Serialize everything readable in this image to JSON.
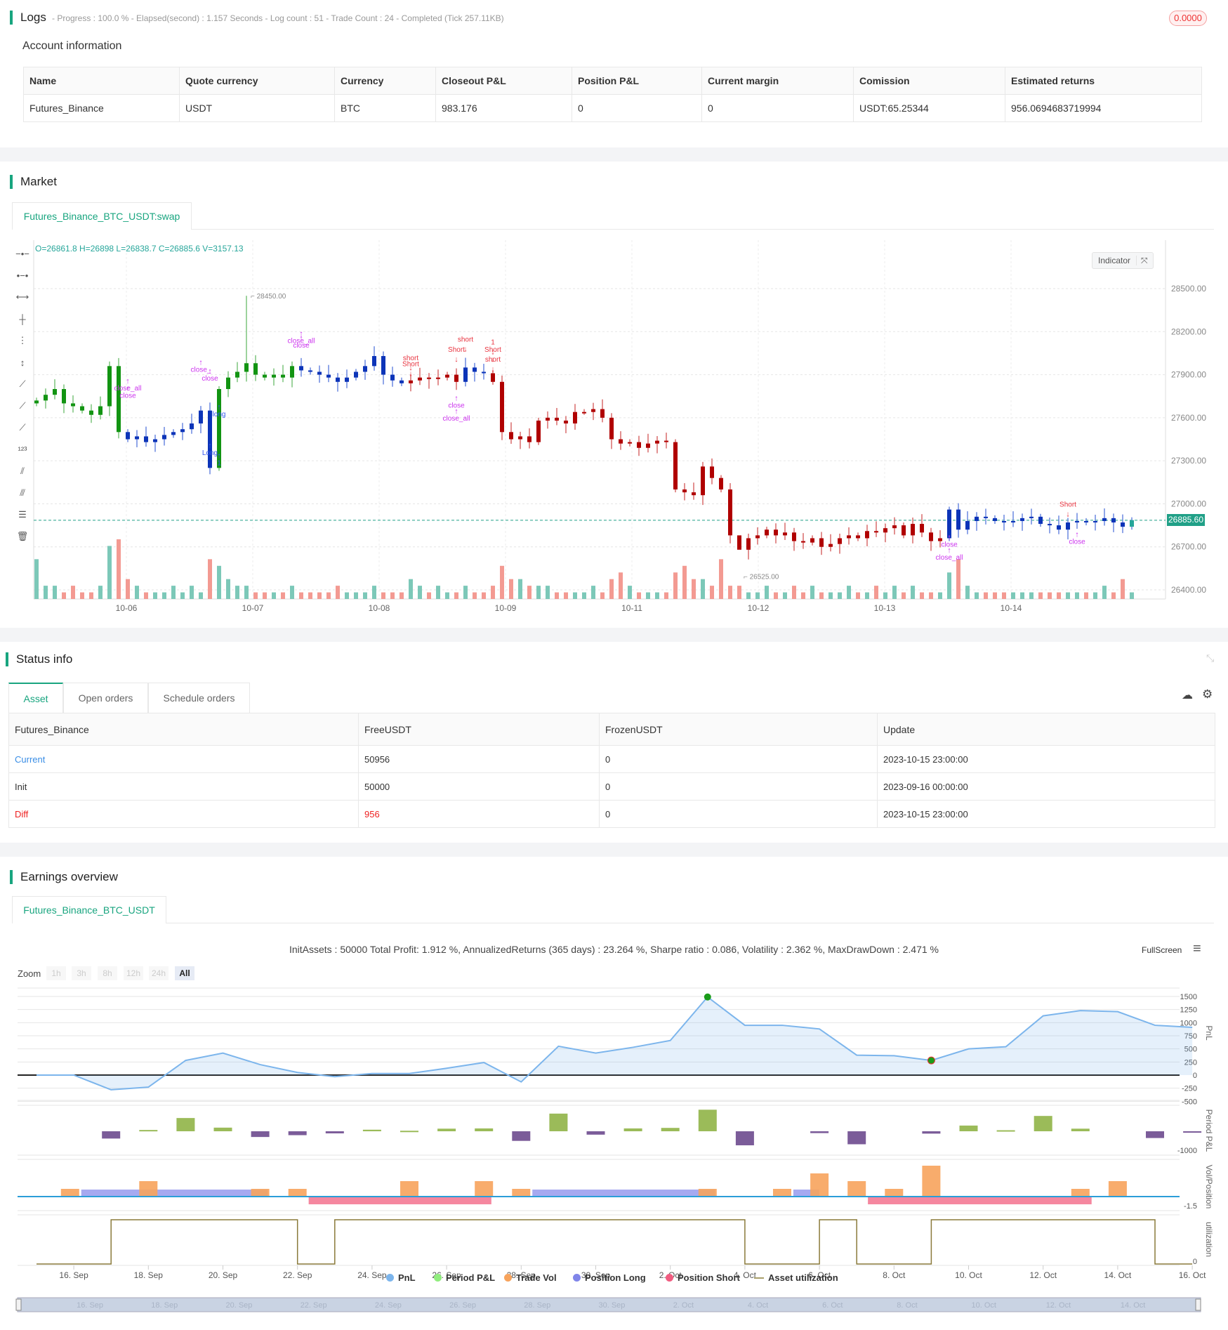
{
  "logs": {
    "title": "Logs",
    "summary": "- Progress : 100.0 % - Elapsed(second) : 1.157  Seconds - Log count : 51 - Trade Count : 24 - Completed (Tick 257.11KB)",
    "badge": "0.0000"
  },
  "account": {
    "title": "Account information",
    "headers": [
      "Name",
      "Quote currency",
      "Currency",
      "Closeout P&L",
      "Position P&L",
      "Current margin",
      "Comission",
      "Estimated returns"
    ],
    "row": [
      "Futures_Binance",
      "USDT",
      "BTC",
      "983.176",
      "0",
      "0",
      "USDT:65.25344",
      "956.0694683719994"
    ]
  },
  "market": {
    "title": "Market",
    "tab": "Futures_Binance_BTC_USDT:swap",
    "ohlc": "O=26861.8 H=26898 L=26838.7 C=26885.6 V=3157.13",
    "indicator_label": "Indicator",
    "last_price": "26885.60"
  },
  "colors": {
    "accent": "#18a57f",
    "long": "#129412",
    "flat": "#0c34b8",
    "short": "#b00000",
    "vol_up": "#7cc8b8",
    "vol_down": "#f39a92",
    "signal": "#cc33ee"
  },
  "chart_data": [
    {
      "type": "candlestick",
      "title": "Futures_Binance_BTC_USDT:swap",
      "ylim": [
        26300,
        28750
      ],
      "yticks": [
        28500,
        28200,
        27900,
        27600,
        27300,
        27000,
        26700,
        26400
      ],
      "xticks": [
        "10-06",
        "10-07",
        "10-08",
        "10-09",
        "10-11",
        "10-12",
        "10-13",
        "10-14"
      ],
      "open_first": 27700,
      "closes": [
        27720,
        27760,
        27800,
        27700,
        27680,
        27650,
        27620,
        27680,
        27960,
        27500,
        27450,
        27470,
        27430,
        27450,
        27480,
        27500,
        27520,
        27560,
        27650,
        27250,
        27800,
        27880,
        27920,
        27980,
        27900,
        27880,
        27900,
        27880,
        27960,
        27930,
        27920,
        27900,
        27880,
        27850,
        27880,
        27920,
        27960,
        28030,
        27900,
        27860,
        27840,
        27860,
        27880,
        27870,
        27880,
        27900,
        27850,
        27950,
        27920,
        27910,
        27850,
        27500,
        27450,
        27470,
        27430,
        27580,
        27600,
        27580,
        27560,
        27640,
        27640,
        27660,
        27600,
        27450,
        27420,
        27430,
        27390,
        27420,
        27440,
        27430,
        27100,
        27080,
        27060,
        27260,
        27180,
        27100,
        26780,
        26680,
        26760,
        26780,
        26820,
        26780,
        26800,
        26740,
        26730,
        26760,
        26700,
        26720,
        26760,
        26780,
        26760,
        26810,
        26800,
        26830,
        26850,
        26780,
        26860,
        26800,
        26740,
        26760,
        26960,
        26820,
        26880,
        26910,
        26900,
        26880,
        26870,
        26880,
        26900,
        26910,
        26860,
        26850,
        26820,
        26870,
        26880,
        26870,
        26880,
        26900,
        26870,
        26840,
        26886
      ],
      "volumes": [
        6,
        2,
        2,
        1,
        2,
        1,
        1,
        2,
        8,
        9,
        3,
        2,
        1,
        1,
        1,
        2,
        1,
        2,
        1,
        6,
        5,
        3,
        2,
        2,
        1,
        1,
        1,
        1,
        2,
        1,
        1,
        1,
        1,
        2,
        1,
        1,
        1,
        2,
        1,
        1,
        1,
        3,
        2,
        1,
        2,
        1,
        1,
        2,
        1,
        1,
        2,
        5,
        3,
        3,
        2,
        2,
        2,
        1,
        1,
        1,
        1,
        2,
        1,
        3,
        4,
        2,
        1,
        1,
        1,
        1,
        4,
        5,
        3,
        3,
        2,
        6,
        2,
        2,
        1,
        1,
        2,
        1,
        1,
        2,
        1,
        2,
        1,
        1,
        1,
        2,
        1,
        1,
        2,
        1,
        2,
        1,
        2,
        1,
        1,
        1,
        4,
        6,
        2,
        1,
        1,
        1,
        1,
        1,
        1,
        1,
        1,
        1,
        1,
        1,
        1,
        1,
        1,
        2,
        1,
        3,
        1
      ],
      "states": [
        {
          "from": 0,
          "to": 9,
          "state": "long"
        },
        {
          "from": 10,
          "to": 19,
          "state": "flat"
        },
        {
          "from": 20,
          "to": 28,
          "state": "long"
        },
        {
          "from": 29,
          "to": 40,
          "state": "flat"
        },
        {
          "from": 41,
          "to": 46,
          "state": "short"
        },
        {
          "from": 47,
          "to": 49,
          "state": "flat"
        },
        {
          "from": 50,
          "to": 99,
          "state": "short"
        },
        {
          "from": 100,
          "to": 120,
          "state": "flat"
        }
      ],
      "extremes": [
        {
          "label": "28450.00",
          "i": 23,
          "price": 28450
        },
        {
          "label": "26525.00",
          "i": 77,
          "price": 26525
        }
      ],
      "signals": [
        {
          "text": "close_all",
          "i": 10,
          "price": 27790,
          "kind": "close"
        },
        {
          "text": "close",
          "i": 10,
          "price": 27740,
          "kind": "close"
        },
        {
          "text": "close_",
          "i": 18,
          "price": 27920,
          "kind": "close"
        },
        {
          "text": "close",
          "i": 19,
          "price": 27860,
          "kind": "close"
        },
        {
          "text": "Long",
          "i": 19,
          "price": 27340,
          "kind": "long"
        },
        {
          "text": "long",
          "i": 20,
          "price": 27610,
          "kind": "long"
        },
        {
          "text": "1",
          "i": 20,
          "price": 27270,
          "kind": "long"
        },
        {
          "text": "close_all",
          "i": 29,
          "price": 28120,
          "kind": "close"
        },
        {
          "text": "close",
          "i": 29,
          "price": 28090,
          "kind": "close"
        },
        {
          "text": "short",
          "i": 41,
          "price": 28000,
          "kind": "short"
        },
        {
          "text": "Short",
          "i": 41,
          "price": 27960,
          "kind": "short"
        },
        {
          "text": "short",
          "i": 47,
          "price": 28130,
          "kind": "short"
        },
        {
          "text": "Short",
          "i": 46,
          "price": 28060,
          "kind": "short"
        },
        {
          "text": "1",
          "i": 50,
          "price": 28110,
          "kind": "short"
        },
        {
          "text": "Short",
          "i": 50,
          "price": 28060,
          "kind": "short"
        },
        {
          "text": "short",
          "i": 50,
          "price": 27990,
          "kind": "short"
        },
        {
          "text": "close",
          "i": 46,
          "price": 27670,
          "kind": "close"
        },
        {
          "text": "close_all",
          "i": 46,
          "price": 27580,
          "kind": "close"
        },
        {
          "text": "close",
          "i": 100,
          "price": 26700,
          "kind": "close"
        },
        {
          "text": "close_all",
          "i": 100,
          "price": 26610,
          "kind": "close"
        },
        {
          "text": "Short",
          "i": 113,
          "price": 26980,
          "kind": "short"
        },
        {
          "text": "close",
          "i": 114,
          "price": 26720,
          "kind": "close"
        }
      ]
    },
    {
      "type": "line",
      "title": "PnL",
      "x": [
        "15 Sep",
        "16 Sep",
        "17 Sep",
        "18 Sep",
        "19 Sep",
        "20 Sep",
        "21 Sep",
        "22 Sep",
        "23 Sep",
        "24 Sep",
        "25 Sep",
        "26 Sep",
        "27 Sep",
        "28 Sep",
        "29 Sep",
        "30 Sep",
        "1 Oct",
        "2 Oct",
        "3 Oct",
        "4 Oct",
        "5 Oct",
        "6 Oct",
        "7 Oct",
        "8 Oct",
        "9 Oct",
        "10 Oct",
        "11 Oct",
        "12 Oct",
        "13 Oct",
        "14 Oct",
        "15 Oct",
        "16 Oct"
      ],
      "pnl": [
        0,
        0,
        -280,
        -230,
        280,
        420,
        200,
        50,
        -30,
        30,
        30,
        130,
        240,
        -130,
        550,
        420,
        530,
        660,
        1490,
        950,
        950,
        880,
        380,
        370,
        280,
        500,
        540,
        1130,
        1230,
        1210,
        950,
        910
      ],
      "ylim": [
        -500,
        1500
      ],
      "yticks": [
        1500,
        1250,
        1000,
        750,
        500,
        250,
        0,
        -250,
        -500
      ],
      "period_pnl": [
        0,
        0,
        -280,
        50,
        510,
        140,
        -220,
        -150,
        -80,
        60,
        20,
        100,
        110,
        -370,
        680,
        -130,
        110,
        130,
        830,
        -540,
        0,
        -70,
        -500,
        0,
        -90,
        220,
        40,
        590,
        100,
        0,
        -260,
        -40
      ],
      "period_ylabel": "-1000",
      "trade_vol": [
        {
          "day": 0.9,
          "vol": 1
        },
        {
          "day": 3,
          "vol": 2
        },
        {
          "day": 6,
          "vol": 1
        },
        {
          "day": 7,
          "vol": 1
        },
        {
          "day": 10,
          "vol": 2
        },
        {
          "day": 12,
          "vol": 2
        },
        {
          "day": 13,
          "vol": 1
        },
        {
          "day": 18,
          "vol": 1
        },
        {
          "day": 20,
          "vol": 1
        },
        {
          "day": 21,
          "vol": 3
        },
        {
          "day": 22,
          "vol": 2
        },
        {
          "day": 23,
          "vol": 1
        },
        {
          "day": 24,
          "vol": 4
        },
        {
          "day": 28,
          "vol": 1
        },
        {
          "day": 29,
          "vol": 2
        }
      ],
      "position_long": [
        [
          1.2,
          6.2
        ],
        [
          13.3,
          18.2
        ],
        [
          20.3,
          21
        ]
      ],
      "position_short": [
        [
          7.3,
          12.2
        ],
        [
          22.3,
          28.3
        ]
      ],
      "vol_ylabel": "-1.5",
      "utilization": [
        0,
        0,
        1,
        1,
        1,
        1,
        1,
        0,
        1,
        1,
        1,
        1,
        1,
        1,
        1,
        1,
        1,
        1,
        1,
        0,
        0,
        1,
        0,
        0,
        1,
        1,
        1,
        1,
        1,
        1,
        0,
        0
      ],
      "util_ylabel": "0",
      "xticks": [
        "16. Sep",
        "18. Sep",
        "20. Sep",
        "22. Sep",
        "24. Sep",
        "26. Sep",
        "28. Sep",
        "30. Sep",
        "2. Oct",
        "4. Oct",
        "6. Oct",
        "8. Oct",
        "10. Oct",
        "12. Oct",
        "14. Oct",
        "16. Oct"
      ],
      "nav_ticks": [
        "16. Sep",
        "18. Sep",
        "20. Sep",
        "22. Sep",
        "24. Sep",
        "26. Sep",
        "28. Sep",
        "30. Sep",
        "2. Oct",
        "4. Oct",
        "6. Oct",
        "8. Oct",
        "10. Oct",
        "12. Oct",
        "14. Oct"
      ],
      "axis_titles": [
        "PnL",
        "Period P&L",
        "Vol/Position",
        "utilization"
      ]
    }
  ],
  "status": {
    "title": "Status info",
    "tabs": [
      "Asset",
      "Open orders",
      "Schedule orders"
    ],
    "headers": [
      "Futures_Binance",
      "FreeUSDT",
      "FrozenUSDT",
      "Update"
    ],
    "rows": [
      [
        "Current",
        "50956",
        "0",
        "2023-10-15 23:00:00"
      ],
      [
        "Init",
        "50000",
        "0",
        "2023-09-16 00:00:00"
      ],
      [
        "Diff",
        "956",
        "0",
        "2023-10-15 23:00:00"
      ]
    ]
  },
  "earnings": {
    "title": "Earnings overview",
    "tab": "Futures_Binance_BTC_USDT",
    "stats": "InitAssets : 50000 Total Profit: 1.912 %, AnnualizedReturns (365 days) : 23.264 %, Sharpe ratio : 0.086, Volatility : 2.362 %, MaxDrawDown : 2.471 %",
    "fullscreen": "FullScreen",
    "zoom_label": "Zoom",
    "zoom_buttons": [
      "1h",
      "3h",
      "8h",
      "12h",
      "24h",
      "All"
    ],
    "legend": [
      {
        "label": "PnL",
        "color": "#7cb5ec"
      },
      {
        "label": "Period P&L",
        "color": "#90ed7d"
      },
      {
        "label": "Trade Vol",
        "color": "#f7a35c"
      },
      {
        "label": "Position Long",
        "color": "#8085e9"
      },
      {
        "label": "Position Short",
        "color": "#f15c80"
      },
      {
        "label": "Asset utilization",
        "color": "#a89f6a"
      }
    ]
  }
}
